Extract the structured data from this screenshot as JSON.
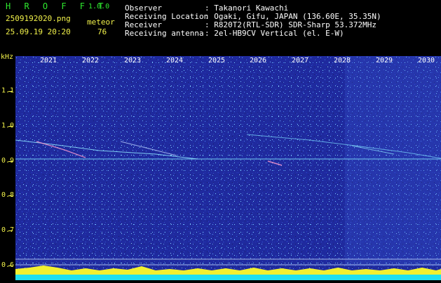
{
  "header": {
    "logo": "H R O F F T",
    "version": "1.0.0",
    "filename": "2509192020.png",
    "datetime": "25.09.19 20:20",
    "counter_label": "meteor",
    "counter_value": "76",
    "fields": [
      {
        "label": "Observer",
        "value": ": Takanori Kawachi"
      },
      {
        "label": "Receiving Location",
        "value": ": Ogaki, Gifu, JAPAN (136.60E, 35.35N)"
      },
      {
        "label": "Receiver",
        "value": ": R820T2(RTL-SDR) SDR-Sharp 53.372MHz"
      },
      {
        "label": "Receiving antenna",
        "value": ": 2el-HB9CV Vertical (el. E-W)"
      }
    ]
  },
  "y_axis": {
    "unit": "kHz",
    "ticks": [
      "1.1",
      "1.0",
      "0.9",
      "0.8",
      "0.7",
      "0.6"
    ]
  },
  "x_axis": {
    "ticks": [
      "2021",
      "2022",
      "2023",
      "2024",
      "2025",
      "2026",
      "2027",
      "2028",
      "2029",
      "2030"
    ]
  },
  "colors": {
    "background": "#000000",
    "spectrogram": "#1f2a9e",
    "axis": "#f2f24a",
    "logo": "#2ee82e",
    "signal": "#7fe0ff"
  }
}
